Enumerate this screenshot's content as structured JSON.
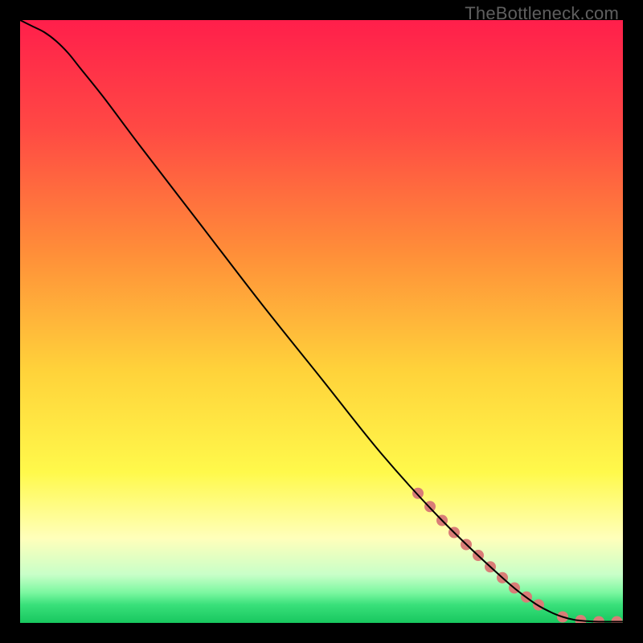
{
  "watermark": "TheBottleneck.com",
  "chart_data": {
    "type": "line",
    "title": "",
    "xlabel": "",
    "ylabel": "",
    "xlim": [
      0,
      100
    ],
    "ylim": [
      0,
      100
    ],
    "grid": false,
    "legend": false,
    "gradient_stops": [
      {
        "pct": 0,
        "color": "#ff1f4b"
      },
      {
        "pct": 18,
        "color": "#ff4944"
      },
      {
        "pct": 38,
        "color": "#ff8c39"
      },
      {
        "pct": 58,
        "color": "#ffd23a"
      },
      {
        "pct": 75,
        "color": "#fff94b"
      },
      {
        "pct": 86,
        "color": "#ffffbb"
      },
      {
        "pct": 92,
        "color": "#c8ffc8"
      },
      {
        "pct": 95,
        "color": "#7bf7a0"
      },
      {
        "pct": 97,
        "color": "#39e07a"
      },
      {
        "pct": 100,
        "color": "#18c75f"
      }
    ],
    "series": [
      {
        "name": "curve",
        "stroke": "#000000",
        "x": [
          0,
          2,
          4,
          6,
          8,
          10,
          14,
          20,
          30,
          40,
          50,
          60,
          70,
          80,
          85,
          88,
          90,
          92,
          94,
          96,
          98,
          100
        ],
        "y": [
          100,
          99,
          98,
          96.5,
          94.5,
          92,
          87,
          79,
          66,
          53,
          40.5,
          28,
          17,
          7.5,
          3.5,
          1.8,
          1.0,
          0.5,
          0.3,
          0.2,
          0.2,
          0.2
        ]
      }
    ],
    "markers": {
      "name": "highlighted-segment",
      "color": "#d97d77",
      "radius": 7,
      "x": [
        66,
        68,
        70,
        72,
        74,
        76,
        78,
        80,
        82,
        84,
        86,
        90,
        93,
        96,
        99
      ],
      "y": [
        21.5,
        19.3,
        17.0,
        15.0,
        13.0,
        11.2,
        9.3,
        7.5,
        5.8,
        4.3,
        3.0,
        1.0,
        0.4,
        0.2,
        0.2
      ]
    }
  }
}
